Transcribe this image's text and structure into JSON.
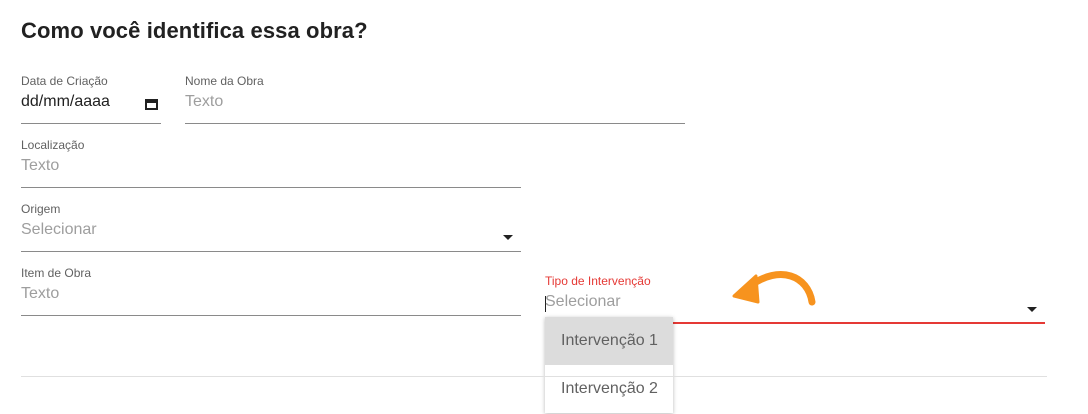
{
  "section": {
    "title": "Como você identifica essa obra?"
  },
  "form": {
    "data_criacao": {
      "label": "Data de Criação",
      "value": "dd/mm/aaaa"
    },
    "nome_obra": {
      "label": "Nome da Obra",
      "placeholder": "Texto"
    },
    "localizacao": {
      "label": "Localização",
      "placeholder": "Texto"
    },
    "origem": {
      "label": "Origem",
      "placeholder": "Selecionar"
    },
    "item_obra": {
      "label": "Item de Obra",
      "placeholder": "Texto"
    },
    "tipo_intervencao": {
      "label": "Tipo de Intervenção",
      "placeholder": "Selecionar",
      "options": [
        "Intervenção 1",
        "Intervenção 2"
      ]
    }
  },
  "colors": {
    "focus_accent": "#e53935",
    "arrow_annotation": "#f7931e"
  },
  "icons": [
    "calendar-icon",
    "dropdown-caret-icon",
    "curved-arrow-icon"
  ]
}
